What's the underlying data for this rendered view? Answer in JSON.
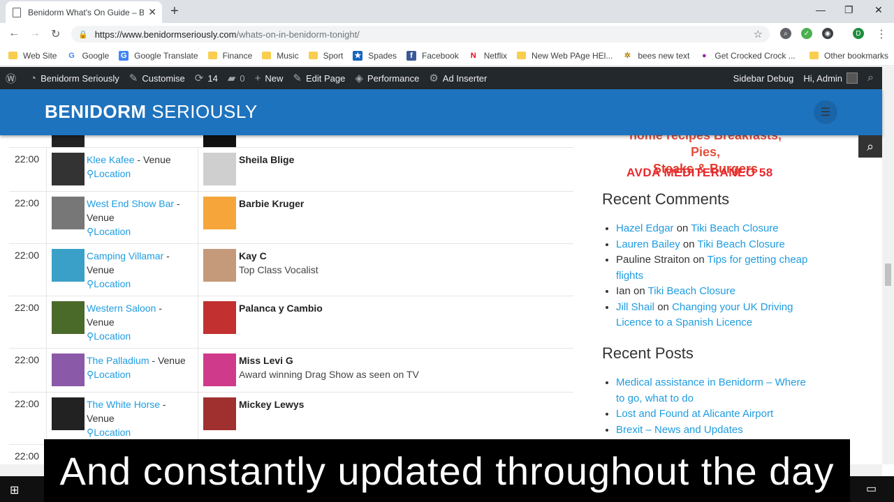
{
  "browser": {
    "tab_title": "Benidorm What's On Guide – Be",
    "url_host": "https://www.benidormseriously.com",
    "url_path": "/whats-on-in-benidorm-tonight/",
    "profile_initial": "D"
  },
  "bookmarks": [
    {
      "label": "Web Site",
      "kind": "folder"
    },
    {
      "label": "Google",
      "kind": "google"
    },
    {
      "label": "Google Translate",
      "kind": "translate"
    },
    {
      "label": "Finance",
      "kind": "folder"
    },
    {
      "label": "Music",
      "kind": "folder"
    },
    {
      "label": "Sport",
      "kind": "folder"
    },
    {
      "label": "Spades",
      "kind": "spades"
    },
    {
      "label": "Facebook",
      "kind": "facebook"
    },
    {
      "label": "Netflix",
      "kind": "netflix"
    },
    {
      "label": "New Web PAge HEl...",
      "kind": "folder"
    },
    {
      "label": "bees new text",
      "kind": "bee"
    },
    {
      "label": "Get Crocked Crock ...",
      "kind": "crock"
    }
  ],
  "bookmarks_overflow": "»",
  "other_bookmarks": "Other bookmarks",
  "adminbar": {
    "site": "Benidorm Seriously",
    "customise": "Customise",
    "updates": "14",
    "comments": "0",
    "new": "New",
    "edit": "Edit Page",
    "performance": "Performance",
    "ad_inserter": "Ad Inserter",
    "sidebar_debug": "Sidebar Debug",
    "greeting": "Hi, Admin"
  },
  "site": {
    "title_bold": "BENIDORM",
    "title_light": "SERIOUSLY"
  },
  "listings": [
    {
      "time": "22:00",
      "venue": "Klee Kafee",
      "venue_suffix": " - Venue",
      "location": "Location",
      "artist": "Sheila Blige",
      "desc": ""
    },
    {
      "time": "22:00",
      "venue": "West End Show Bar",
      "venue_suffix": " - Venue",
      "location": "Location",
      "artist": "Barbie Kruger",
      "desc": ""
    },
    {
      "time": "22:00",
      "venue": "Camping Villamar",
      "venue_suffix": " - Venue",
      "location": "Location",
      "artist": "Kay C",
      "desc": "Top Class Vocalist"
    },
    {
      "time": "22:00",
      "venue": "Western Saloon",
      "venue_suffix": " - Venue",
      "location": "Location",
      "artist": "Palanca y Cambio",
      "desc": ""
    },
    {
      "time": "22:00",
      "venue": "The Palladium",
      "venue_suffix": " - Venue",
      "location": "Location",
      "artist": "Miss Levi G",
      "desc": "Award winning Drag Show as seen on TV"
    },
    {
      "time": "22:00",
      "venue": "The White Horse",
      "venue_suffix": " - Venue",
      "location": "Location",
      "artist": "Mickey Lewys",
      "desc": ""
    },
    {
      "time": "22:00",
      "venue": "",
      "venue_suffix": "",
      "location": "",
      "artist": "",
      "desc": ""
    }
  ],
  "sidebar": {
    "promo_line1": "home recipes Breakfasts, Pies,",
    "promo_line2": "Steaks & Burgers",
    "promo_address": "AVDA MEDITERANEO 58",
    "recent_comments_title": "Recent Comments",
    "recent_comments": [
      {
        "author": "Hazel Edgar",
        "author_link": true,
        "on": " on ",
        "post": "Tiki Beach Closure"
      },
      {
        "author": "Lauren Bailey",
        "author_link": true,
        "on": " on ",
        "post": "Tiki Beach Closure"
      },
      {
        "author": "Pauline Straiton",
        "author_link": false,
        "on": " on ",
        "post": "Tips for getting cheap flights"
      },
      {
        "author": "Ian",
        "author_link": false,
        "on": " on ",
        "post": "Tiki Beach Closure"
      },
      {
        "author": "Jill Shail",
        "author_link": true,
        "on": " on ",
        "post": "Changing your UK Driving Licence to a Spanish Licence"
      }
    ],
    "recent_posts_title": "Recent Posts",
    "recent_posts": [
      "Medical assistance in Benidorm – Where to go, what to do",
      "Lost and Found at Alicante Airport",
      "Brexit – News and Updates"
    ]
  },
  "caption": "And constantly updated throughout the day",
  "colors": {
    "header_blue": "#1e73be",
    "link_blue": "#1e9ce0",
    "adminbar": "#23282d",
    "promo_red": "#e23b2a"
  }
}
